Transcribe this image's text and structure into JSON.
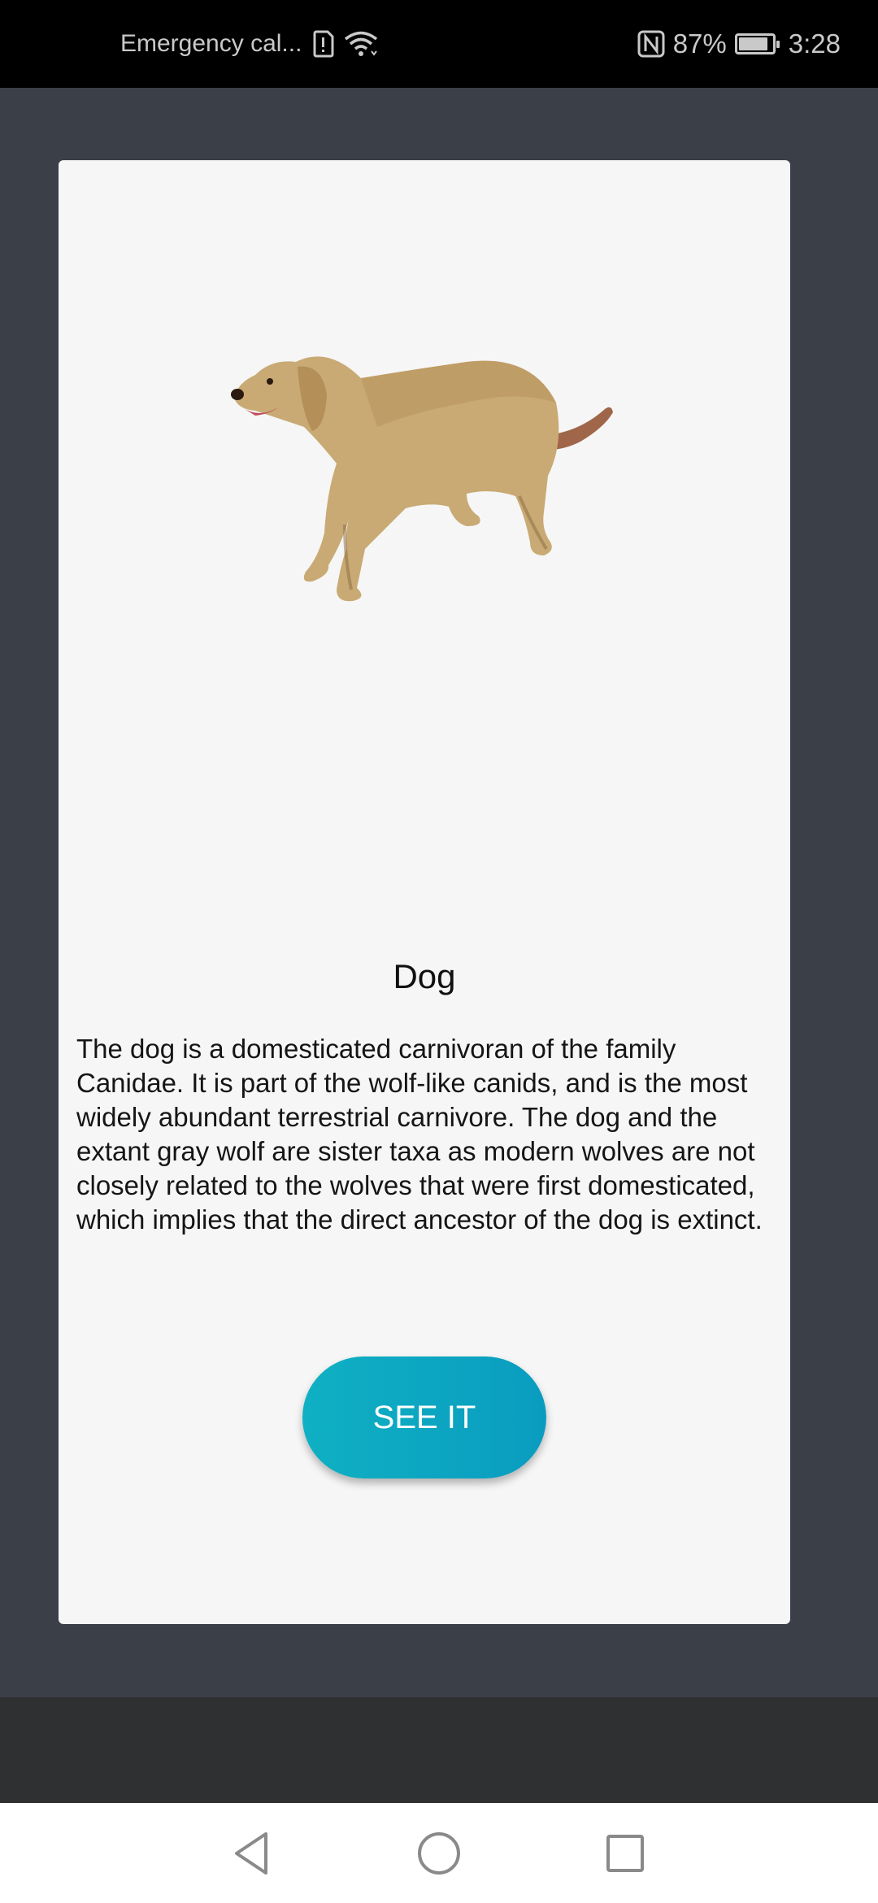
{
  "status_bar": {
    "carrier": "Emergency cal...",
    "battery_percent": "87%",
    "time": "3:28",
    "battery_level": 0.87,
    "icons": [
      "sim-alert-icon",
      "wifi-icon",
      "nfc-icon",
      "battery-icon"
    ]
  },
  "card": {
    "title": "Dog",
    "description": "The dog is a domesticated carnivoran of the family Canidae. It is part of the wolf-like canids, and is the most widely abundant terrestrial carnivore. The dog and the extant gray wolf are sister taxa as modern wolves are not closely related to the wolves that were first domesticated, which implies that the direct ancestor of the dog is extinct.",
    "button_label": "SEE IT",
    "button_color": "#0fa9c2"
  },
  "nav_bar": {
    "icons": [
      "back-icon",
      "home-icon",
      "recents-icon"
    ]
  }
}
